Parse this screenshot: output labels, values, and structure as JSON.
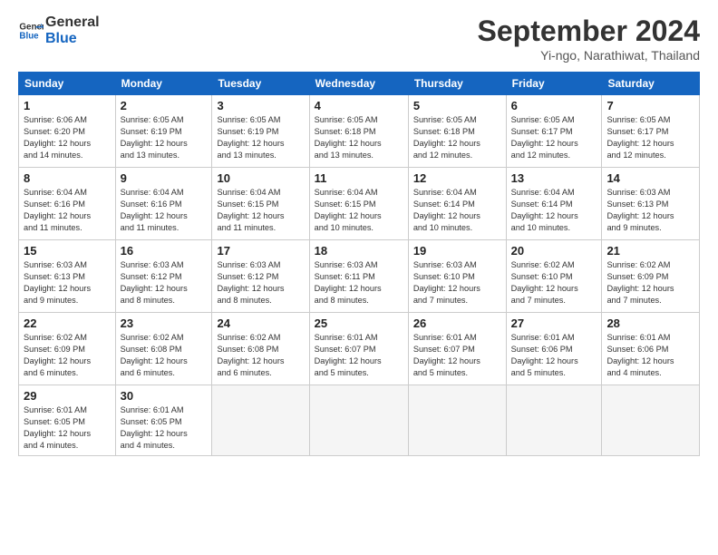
{
  "header": {
    "logo_line1": "General",
    "logo_line2": "Blue",
    "month_title": "September 2024",
    "location": "Yi-ngo, Narathiwat, Thailand"
  },
  "days_of_week": [
    "Sunday",
    "Monday",
    "Tuesday",
    "Wednesday",
    "Thursday",
    "Friday",
    "Saturday"
  ],
  "weeks": [
    [
      {
        "day": "1",
        "info": "Sunrise: 6:06 AM\nSunset: 6:20 PM\nDaylight: 12 hours\nand 14 minutes."
      },
      {
        "day": "2",
        "info": "Sunrise: 6:05 AM\nSunset: 6:19 PM\nDaylight: 12 hours\nand 13 minutes."
      },
      {
        "day": "3",
        "info": "Sunrise: 6:05 AM\nSunset: 6:19 PM\nDaylight: 12 hours\nand 13 minutes."
      },
      {
        "day": "4",
        "info": "Sunrise: 6:05 AM\nSunset: 6:18 PM\nDaylight: 12 hours\nand 13 minutes."
      },
      {
        "day": "5",
        "info": "Sunrise: 6:05 AM\nSunset: 6:18 PM\nDaylight: 12 hours\nand 12 minutes."
      },
      {
        "day": "6",
        "info": "Sunrise: 6:05 AM\nSunset: 6:17 PM\nDaylight: 12 hours\nand 12 minutes."
      },
      {
        "day": "7",
        "info": "Sunrise: 6:05 AM\nSunset: 6:17 PM\nDaylight: 12 hours\nand 12 minutes."
      }
    ],
    [
      {
        "day": "8",
        "info": "Sunrise: 6:04 AM\nSunset: 6:16 PM\nDaylight: 12 hours\nand 11 minutes."
      },
      {
        "day": "9",
        "info": "Sunrise: 6:04 AM\nSunset: 6:16 PM\nDaylight: 12 hours\nand 11 minutes."
      },
      {
        "day": "10",
        "info": "Sunrise: 6:04 AM\nSunset: 6:15 PM\nDaylight: 12 hours\nand 11 minutes."
      },
      {
        "day": "11",
        "info": "Sunrise: 6:04 AM\nSunset: 6:15 PM\nDaylight: 12 hours\nand 10 minutes."
      },
      {
        "day": "12",
        "info": "Sunrise: 6:04 AM\nSunset: 6:14 PM\nDaylight: 12 hours\nand 10 minutes."
      },
      {
        "day": "13",
        "info": "Sunrise: 6:04 AM\nSunset: 6:14 PM\nDaylight: 12 hours\nand 10 minutes."
      },
      {
        "day": "14",
        "info": "Sunrise: 6:03 AM\nSunset: 6:13 PM\nDaylight: 12 hours\nand 9 minutes."
      }
    ],
    [
      {
        "day": "15",
        "info": "Sunrise: 6:03 AM\nSunset: 6:13 PM\nDaylight: 12 hours\nand 9 minutes."
      },
      {
        "day": "16",
        "info": "Sunrise: 6:03 AM\nSunset: 6:12 PM\nDaylight: 12 hours\nand 8 minutes."
      },
      {
        "day": "17",
        "info": "Sunrise: 6:03 AM\nSunset: 6:12 PM\nDaylight: 12 hours\nand 8 minutes."
      },
      {
        "day": "18",
        "info": "Sunrise: 6:03 AM\nSunset: 6:11 PM\nDaylight: 12 hours\nand 8 minutes."
      },
      {
        "day": "19",
        "info": "Sunrise: 6:03 AM\nSunset: 6:10 PM\nDaylight: 12 hours\nand 7 minutes."
      },
      {
        "day": "20",
        "info": "Sunrise: 6:02 AM\nSunset: 6:10 PM\nDaylight: 12 hours\nand 7 minutes."
      },
      {
        "day": "21",
        "info": "Sunrise: 6:02 AM\nSunset: 6:09 PM\nDaylight: 12 hours\nand 7 minutes."
      }
    ],
    [
      {
        "day": "22",
        "info": "Sunrise: 6:02 AM\nSunset: 6:09 PM\nDaylight: 12 hours\nand 6 minutes."
      },
      {
        "day": "23",
        "info": "Sunrise: 6:02 AM\nSunset: 6:08 PM\nDaylight: 12 hours\nand 6 minutes."
      },
      {
        "day": "24",
        "info": "Sunrise: 6:02 AM\nSunset: 6:08 PM\nDaylight: 12 hours\nand 6 minutes."
      },
      {
        "day": "25",
        "info": "Sunrise: 6:01 AM\nSunset: 6:07 PM\nDaylight: 12 hours\nand 5 minutes."
      },
      {
        "day": "26",
        "info": "Sunrise: 6:01 AM\nSunset: 6:07 PM\nDaylight: 12 hours\nand 5 minutes."
      },
      {
        "day": "27",
        "info": "Sunrise: 6:01 AM\nSunset: 6:06 PM\nDaylight: 12 hours\nand 5 minutes."
      },
      {
        "day": "28",
        "info": "Sunrise: 6:01 AM\nSunset: 6:06 PM\nDaylight: 12 hours\nand 4 minutes."
      }
    ],
    [
      {
        "day": "29",
        "info": "Sunrise: 6:01 AM\nSunset: 6:05 PM\nDaylight: 12 hours\nand 4 minutes."
      },
      {
        "day": "30",
        "info": "Sunrise: 6:01 AM\nSunset: 6:05 PM\nDaylight: 12 hours\nand 4 minutes."
      },
      {
        "day": "",
        "info": ""
      },
      {
        "day": "",
        "info": ""
      },
      {
        "day": "",
        "info": ""
      },
      {
        "day": "",
        "info": ""
      },
      {
        "day": "",
        "info": ""
      }
    ]
  ]
}
